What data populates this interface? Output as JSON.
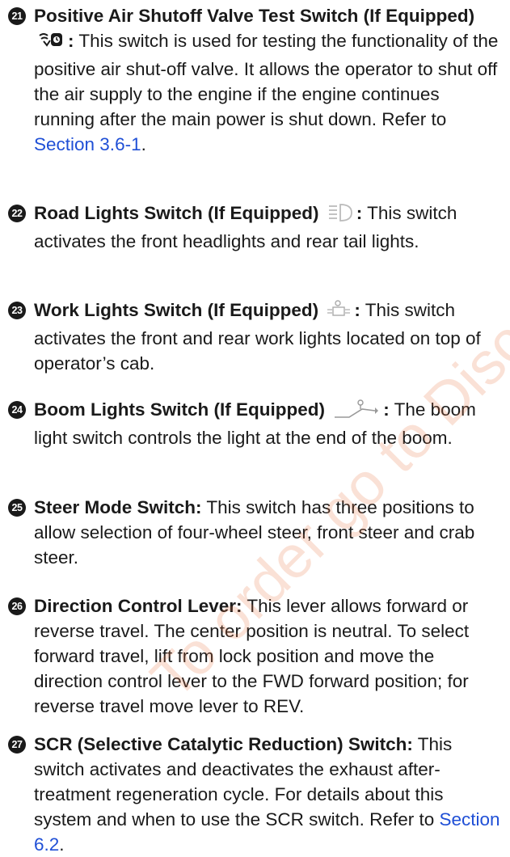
{
  "items": [
    {
      "number": "21",
      "title": "Positive Air Shutoff Valve Test Switch (If Equipped)",
      "icon": "air-shutoff-valve-icon",
      "body": "This switch is used for testing the functionality of the positive air shut-off valve. It allows the operator to shut off the air supply to the engine if the engine continues running after the main power is shut down. Refer to",
      "link": "Section 3.6-1",
      "tail": "."
    },
    {
      "number": "22",
      "title": "Road Lights Switch (If Equipped)",
      "icon": "headlight-icon",
      "body": "This switch activates the front headlights and rear tail lights."
    },
    {
      "number": "23",
      "title": "Work Lights Switch (If Equipped)",
      "icon": "work-light-icon",
      "body": "This switch activates the front and rear work lights located on top of operator’s cab."
    },
    {
      "number": "24",
      "title": "Boom Lights Switch (If Equipped)",
      "icon": "boom-light-icon",
      "body": "The boom light switch controls the light at the end of the boom."
    },
    {
      "number": "25",
      "title": "Steer Mode Switch:",
      "body": "This switch has three positions to allow selection of four-wheel steer, front steer and crab steer."
    },
    {
      "number": "26",
      "title": "Direction Control Lever:",
      "body": "This lever allows forward or reverse travel. The center position is neutral. To select forward travel, lift from lock position and move the direction control lever to the FWD forward position; for reverse travel move lever to REV."
    },
    {
      "number": "27",
      "title": "SCR (Selective Catalytic Reduction) Switch:",
      "body": "This switch activates and deactivates the exhaust after-treatment regeneration cycle. For details about this system and when to use the SCR switch. Refer to",
      "link": "Section 6.2",
      "tail": "."
    }
  ],
  "watermark": "To order go to Discount",
  "colors": {
    "text": "#1a1a1a",
    "link": "#1f4fd6",
    "watermark": "#e67846"
  }
}
